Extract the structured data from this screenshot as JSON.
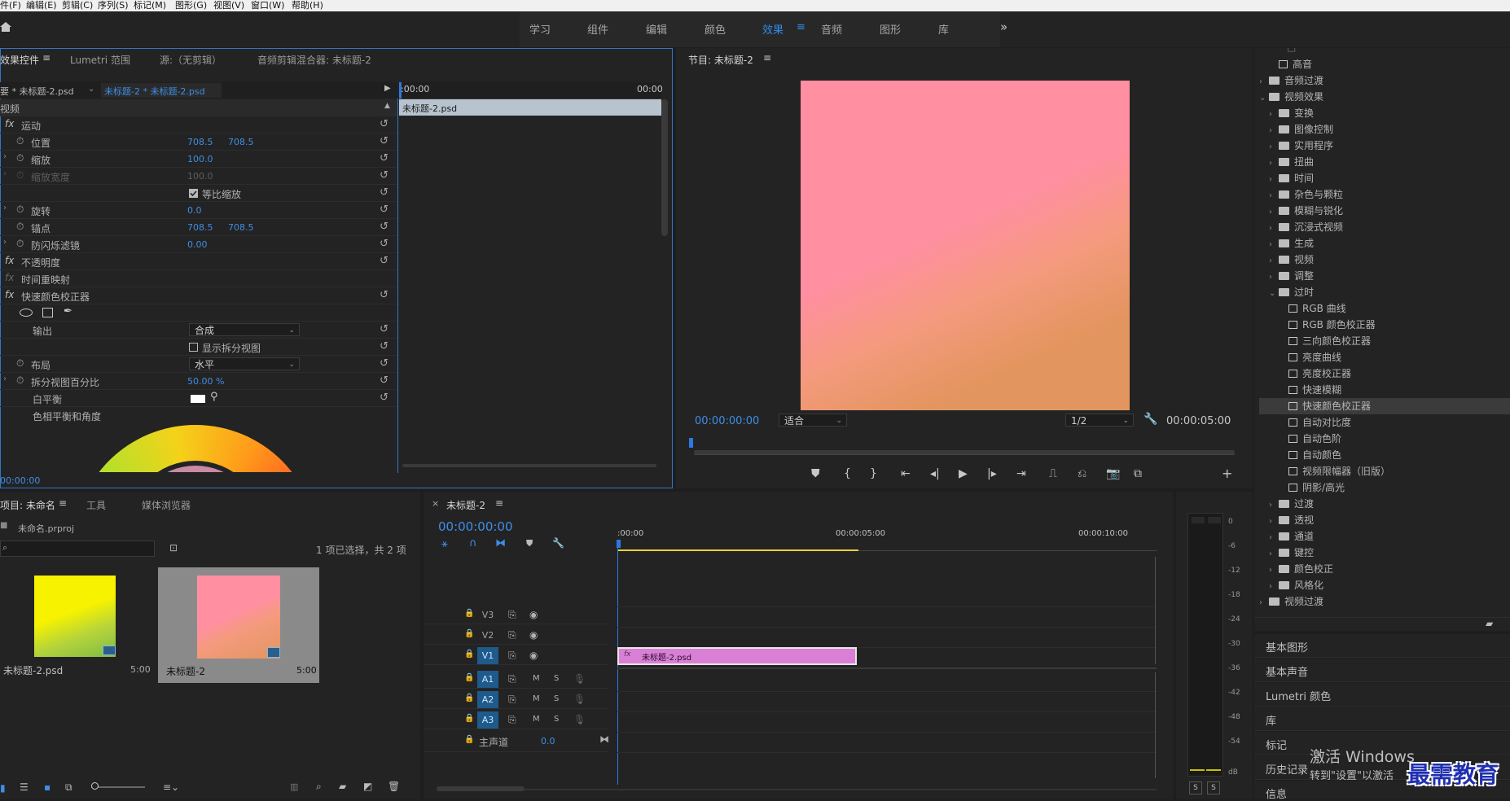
{
  "menu": [
    "件(F)",
    "编辑(E)",
    "剪辑(C)",
    "序列(S)",
    "标记(M)",
    "图形(G)",
    "视图(V)",
    "窗口(W)",
    "帮助(H)"
  ],
  "workspaces": [
    "学习",
    "组件",
    "编辑",
    "颜色",
    "效果",
    "音频",
    "图形",
    "库"
  ],
  "workspace_active": "效果",
  "ec": {
    "tabs": [
      "效果控件",
      "Lumetri 范围",
      "源:（无剪辑）",
      "音频剪辑混合器: 未标题-2"
    ],
    "source_clip": "要 * 未标题-2.psd",
    "seq_clip": "未标题-2 * 未标题-2.psd",
    "section": "视频",
    "ruler_start": ":00:00",
    "ruler_end": "00:00",
    "clip_bar": "未标题-2.psd",
    "motion": "运动",
    "position_label": "位置",
    "pos_x": "708.5",
    "pos_y": "708.5",
    "scale_label": "缩放",
    "scale_val": "100.0",
    "scale_width_label": "缩放宽度",
    "scale_width_val": "100.0",
    "uniform_label": "等比缩放",
    "rotation_label": "旋转",
    "rotation_val": "0.0",
    "anchor_label": "锚点",
    "anchor_x": "708.5",
    "anchor_y": "708.5",
    "flicker_label": "防闪烁滤镜",
    "flicker_val": "0.00",
    "opacity": "不透明度",
    "time_remap": "时间重映射",
    "fast_color": "快速颜色校正器",
    "output_label": "输出",
    "output_val": "合成",
    "split_label": "显示拆分视图",
    "layout_label": "布局",
    "layout_val": "水平",
    "split_pct_label": "拆分视图百分比",
    "split_pct_val": "50.00 %",
    "wb_label": "白平衡",
    "hue_label": "色相平衡和角度",
    "timecode": "00:00:00"
  },
  "program": {
    "title": "节目: 未标题-2",
    "timecode": "00:00:00:00",
    "fit": "适合",
    "quality": "1/2",
    "duration": "00:00:05:00"
  },
  "project": {
    "tabs": [
      "项目: 未命名",
      "工具",
      "媒体浏览器"
    ],
    "file": "未命名.prproj",
    "selection": "1 项已选择，共 2 项",
    "items": [
      {
        "name": "未标题-2.psd",
        "dur": "5:00"
      },
      {
        "name": "未标题-2",
        "dur": "5:00"
      }
    ]
  },
  "timeline": {
    "tab": "未标题-2",
    "timecode": "00:00:00:00",
    "ruler": [
      ":00:00",
      "00:00:05:00",
      "00:00:10:00"
    ],
    "video_tracks": [
      "V3",
      "V2",
      "V1"
    ],
    "audio_tracks": [
      "A1",
      "A2",
      "A3"
    ],
    "master": "主声道",
    "master_val": "0.0",
    "clip": "未标题-2.psd",
    "m": "M",
    "s": "S"
  },
  "meter": {
    "scale": [
      "0",
      "-6",
      "-12",
      "-18",
      "-24",
      "-30",
      "-36",
      "-42",
      "-48",
      "-54",
      "dB"
    ],
    "solo": [
      "S",
      "S"
    ]
  },
  "effects_tree": [
    {
      "label": "高音",
      "type": "fx",
      "level": 1
    },
    {
      "label": "音频过渡",
      "type": "folder",
      "level": 0,
      "chev": "›"
    },
    {
      "label": "视频效果",
      "type": "folder",
      "level": 0,
      "chev": "⌄"
    },
    {
      "label": "变换",
      "type": "folder",
      "level": 1,
      "chev": "›"
    },
    {
      "label": "图像控制",
      "type": "folder",
      "level": 1,
      "chev": "›"
    },
    {
      "label": "实用程序",
      "type": "folder",
      "level": 1,
      "chev": "›"
    },
    {
      "label": "扭曲",
      "type": "folder",
      "level": 1,
      "chev": "›"
    },
    {
      "label": "时间",
      "type": "folder",
      "level": 1,
      "chev": "›"
    },
    {
      "label": "杂色与颗粒",
      "type": "folder",
      "level": 1,
      "chev": "›"
    },
    {
      "label": "模糊与锐化",
      "type": "folder",
      "level": 1,
      "chev": "›"
    },
    {
      "label": "沉浸式视频",
      "type": "folder",
      "level": 1,
      "chev": "›"
    },
    {
      "label": "生成",
      "type": "folder",
      "level": 1,
      "chev": "›"
    },
    {
      "label": "视频",
      "type": "folder",
      "level": 1,
      "chev": "›"
    },
    {
      "label": "调整",
      "type": "folder",
      "level": 1,
      "chev": "›"
    },
    {
      "label": "过时",
      "type": "folder",
      "level": 1,
      "chev": "⌄"
    },
    {
      "label": "RGB 曲线",
      "type": "fx",
      "level": 2
    },
    {
      "label": "RGB 颜色校正器",
      "type": "fx",
      "level": 2
    },
    {
      "label": "三向颜色校正器",
      "type": "fx",
      "level": 2
    },
    {
      "label": "亮度曲线",
      "type": "fx",
      "level": 2
    },
    {
      "label": "亮度校正器",
      "type": "fx",
      "level": 2
    },
    {
      "label": "快速模糊",
      "type": "fx",
      "level": 2
    },
    {
      "label": "快速颜色校正器",
      "type": "fx",
      "level": 2,
      "selected": true
    },
    {
      "label": "自动对比度",
      "type": "fx",
      "level": 2
    },
    {
      "label": "自动色阶",
      "type": "fx",
      "level": 2
    },
    {
      "label": "自动颜色",
      "type": "fx",
      "level": 2
    },
    {
      "label": "视频限幅器（旧版）",
      "type": "fx",
      "level": 2
    },
    {
      "label": "阴影/高光",
      "type": "fx",
      "level": 2
    },
    {
      "label": "过渡",
      "type": "folder",
      "level": 1,
      "chev": "›"
    },
    {
      "label": "透视",
      "type": "folder",
      "level": 1,
      "chev": "›"
    },
    {
      "label": "通道",
      "type": "folder",
      "level": 1,
      "chev": "›"
    },
    {
      "label": "键控",
      "type": "folder",
      "level": 1,
      "chev": "›"
    },
    {
      "label": "颜色校正",
      "type": "folder",
      "level": 1,
      "chev": "›"
    },
    {
      "label": "风格化",
      "type": "folder",
      "level": 1,
      "chev": "›"
    },
    {
      "label": "视频过渡",
      "type": "folder",
      "level": 0,
      "chev": "›"
    }
  ],
  "collapsed_panels": [
    "基本图形",
    "基本声音",
    "Lumetri 颜色",
    "库",
    "标记",
    "历史记录",
    "信息"
  ],
  "watermark": {
    "line1": "激活 Windows",
    "line2": "转到\"设置\"以激活",
    "logo": "最需教育"
  },
  "colors": {
    "accent": "#2d8ceb",
    "gradient_pink": "#ff8fa1",
    "gradient_orange": "#e3955f",
    "clip_fill": "#d980d6",
    "thumb_yellow": "#f6f200",
    "thumb_green": "#7fbb46"
  }
}
